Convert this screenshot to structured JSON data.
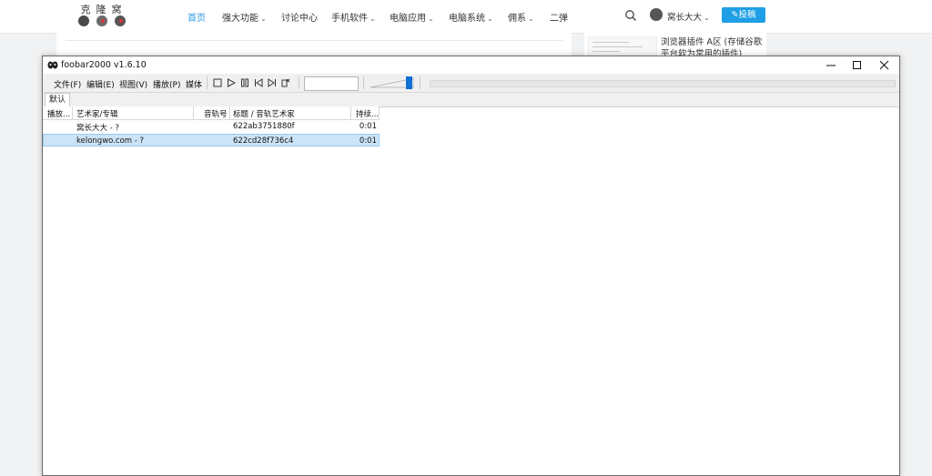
{
  "site": {
    "logo_text": "克隆窝",
    "nav": [
      {
        "label": "首页",
        "active": true,
        "dropdown": false
      },
      {
        "label": "强大功能",
        "active": false,
        "dropdown": true
      },
      {
        "label": "讨论中心",
        "active": false,
        "dropdown": false
      },
      {
        "label": "手机软件",
        "active": false,
        "dropdown": true
      },
      {
        "label": "电脑应用",
        "active": false,
        "dropdown": true
      },
      {
        "label": "电脑系统",
        "active": false,
        "dropdown": true
      },
      {
        "label": "佣系",
        "active": false,
        "dropdown": true
      },
      {
        "label": "二弹",
        "active": false,
        "dropdown": false
      }
    ],
    "chevron": "⌄",
    "user_name": "窝长大大",
    "post_button": "✎投稿",
    "sidebar_title": "浏览器插件 A区 (存储谷歌平台软为常用的插件)"
  },
  "window": {
    "title": "foobar2000 v1.6.10",
    "menu": [
      "文件(F)",
      "编辑(E)",
      "视图(V)",
      "播放(P)",
      "媒体"
    ],
    "tab_label": "默认",
    "columns": {
      "playing": "播放...",
      "artist_album": "艺术家/专辑",
      "track_no": "音轨号",
      "title_artist": "标题 / 音轨艺术家",
      "duration": "持续..."
    },
    "rows": [
      {
        "artist_album": "窝长大大 - ?",
        "track_no": "",
        "title": "622ab3751880f",
        "duration": "0:01",
        "selected": false
      },
      {
        "artist_album": "kelongwo.com - ?",
        "track_no": "",
        "title": "622cd28f736c4",
        "duration": "0:01",
        "selected": true
      }
    ],
    "volume_level": 0.95
  },
  "colors": {
    "accent": "#2b9ae5",
    "button": "#1e9fe6",
    "selection": "#cce4f7"
  }
}
